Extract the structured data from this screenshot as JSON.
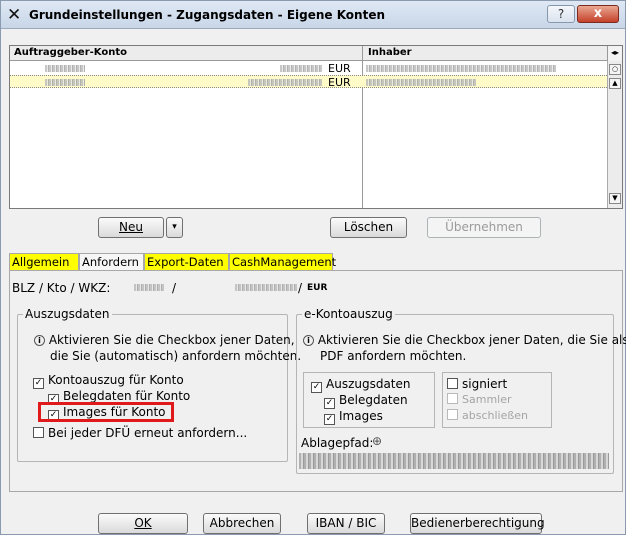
{
  "window": {
    "title": "Grundeinstellungen - Zugangsdaten - Eigene Konten",
    "help_label": "?",
    "close_label": "x",
    "app_icon": "raiffeisen-x-icon"
  },
  "accounts_table": {
    "columns": [
      "Auftraggeber-Konto",
      "Inhaber"
    ],
    "rows": [
      {
        "currency": "EUR",
        "selected": false
      },
      {
        "currency": "EUR",
        "selected": true
      }
    ]
  },
  "table_buttons": {
    "neu": "Neu",
    "neu_dropdown": "▾",
    "loeschen": "Löschen",
    "uebernehmen": "Übernehmen"
  },
  "tabs": [
    "Allgemein",
    "Anfordern",
    "Export-Daten",
    "CashManagement"
  ],
  "active_tab": "Anfordern",
  "blz_row": {
    "label": "BLZ / Kto / WKZ:",
    "separator": "/",
    "separator2": "/",
    "currency": "EUR"
  },
  "auszugsdaten": {
    "title": "Auszugsdaten",
    "info": "Aktivieren Sie die Checkbox jener Daten, die Sie (automatisch) anfordern möchten.",
    "info_line1": "Aktivieren Sie die Checkbox jener Daten,",
    "info_line2": "die Sie (automatisch) anfordern möchten.",
    "checkboxes": [
      {
        "label": "Kontoauszug für Konto",
        "checked": true
      },
      {
        "label": "Belegdaten für Konto",
        "checked": true
      },
      {
        "label": "Images für Konto",
        "checked": true
      },
      {
        "label": "Bei jeder DFÜ erneut anfordern...",
        "checked": false
      }
    ]
  },
  "e_kontoauszug": {
    "title": "e-Kontoauszug",
    "info_line1": "Aktivieren Sie die Checkbox jener Daten, die Sie als",
    "info_line2": "PDF anfordern möchten.",
    "checkboxes_left": [
      {
        "label": "Auszugsdaten",
        "checked": true
      },
      {
        "label": "Belegdaten",
        "checked": true
      },
      {
        "label": "Images",
        "checked": true
      }
    ],
    "checkboxes_right": [
      {
        "label": "signiert",
        "checked": false,
        "enabled": true
      },
      {
        "label": "Sammler",
        "checked": false,
        "enabled": false
      },
      {
        "label": "abschließen",
        "checked": false,
        "enabled": false
      }
    ],
    "ablagepfad_label": "Ablagepfad:"
  },
  "bottom_buttons": {
    "ok": "OK",
    "abbrechen": "Abbrechen",
    "iban_bic": "IBAN / BIC",
    "bediener": "Bedienerberechtigung"
  },
  "colors": {
    "tab_highlight": "#ffff00",
    "selected_row": "#fffbc9",
    "highlight_box": "#e01a1a"
  }
}
